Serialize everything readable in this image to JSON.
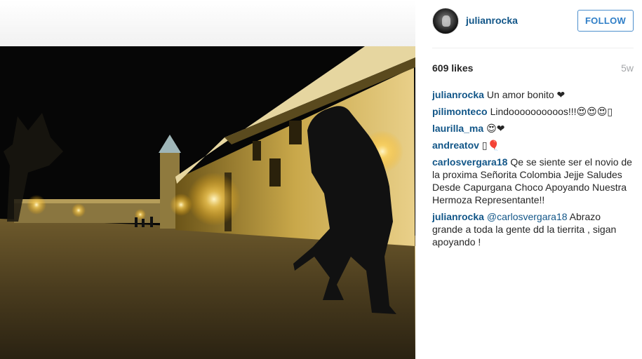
{
  "post": {
    "username": "julianrocka",
    "follow_label": "FOLLOW",
    "likes": "609 likes",
    "time_ago": "5w"
  },
  "comments": [
    {
      "author": "julianrocka",
      "text": "Un amor bonito ❤"
    },
    {
      "author": "pilimonteco",
      "text": "Lindoooooooooos!!!😍😍😍▯"
    },
    {
      "author": "laurilla_ma",
      "text": "😍❤"
    },
    {
      "author": "andreatov",
      "text": "▯🎈"
    },
    {
      "author": "carlosvergara18",
      "text": "Qe se siente ser el novio de la proxima Señorita Colombia Jejje Saludes Desde Capurgana Choco Apoyando Nuestra Hermoza Representante!!"
    },
    {
      "author": "julianrocka",
      "mention": "@carlosvergara18",
      "text": "Abrazo grande a toda la gente dd la tierrita , sigan apoyando !"
    }
  ],
  "colors": {
    "username": "#125688",
    "follow": "#2f7ec7",
    "timestamp": "#a5a7aa"
  }
}
